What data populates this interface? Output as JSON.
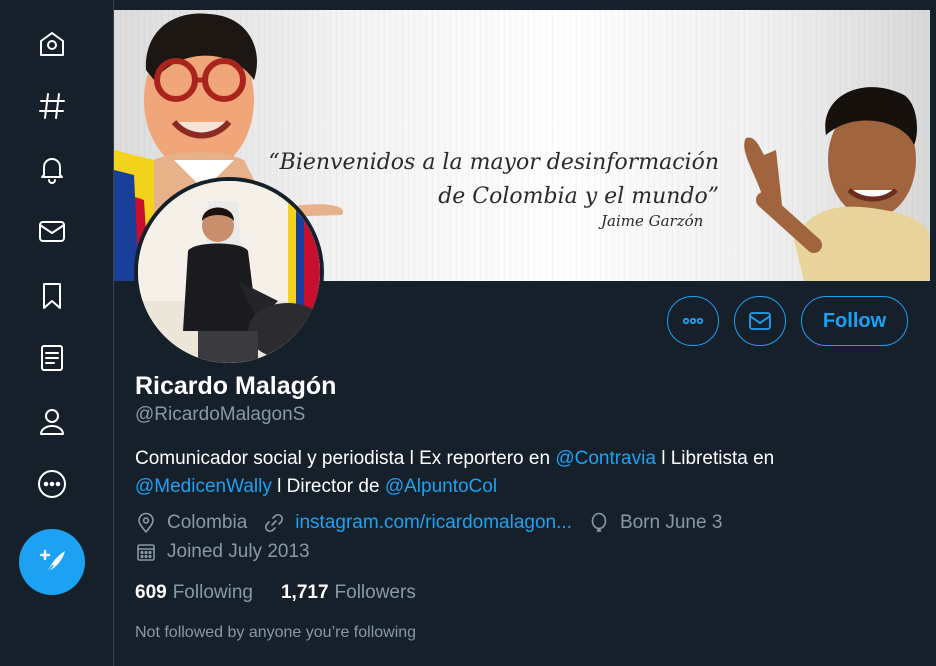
{
  "nav": {
    "items": [
      {
        "name": "home-icon"
      },
      {
        "name": "explore-hashtag-icon"
      },
      {
        "name": "notifications-bell-icon"
      },
      {
        "name": "messages-envelope-icon"
      },
      {
        "name": "bookmarks-icon"
      },
      {
        "name": "lists-icon"
      },
      {
        "name": "profile-person-icon"
      },
      {
        "name": "more-circle-icon"
      }
    ],
    "tweet_button": {
      "icon": "feather-plus-icon",
      "color": "#1da1f2"
    }
  },
  "banner": {
    "quote_line1": "“Bienvenidos a la mayor desinformación",
    "quote_line2": "de Colombia y el mundo”",
    "quote_author": "Jaime Garzón"
  },
  "profile": {
    "display_name": "Ricardo Malagón",
    "handle": "@RicardoMalagonS",
    "bio": {
      "part1": "Comunicador social y periodista l Ex reportero en ",
      "mention1": "@Contravia",
      "part2": " l Libretista en ",
      "mention2": "@MedicenWally",
      "part3": " l Director de ",
      "mention3": "@AlpuntoCol"
    },
    "location": "Colombia",
    "website": "instagram.com/ricardomalagon...",
    "birthday": "Born June 3",
    "joined": "Joined July 2013",
    "following_count": "609",
    "following_label": "Following",
    "followers_count": "1,717",
    "followers_label": "Followers",
    "followed_by_note": "Not followed by anyone you’re following"
  },
  "actions": {
    "more_icon": "more-horizontal-icon",
    "message_icon": "envelope-icon",
    "follow_label": "Follow"
  },
  "colors": {
    "background": "#15202b",
    "accent": "#1da1f2",
    "secondary_text": "#8899a6"
  }
}
